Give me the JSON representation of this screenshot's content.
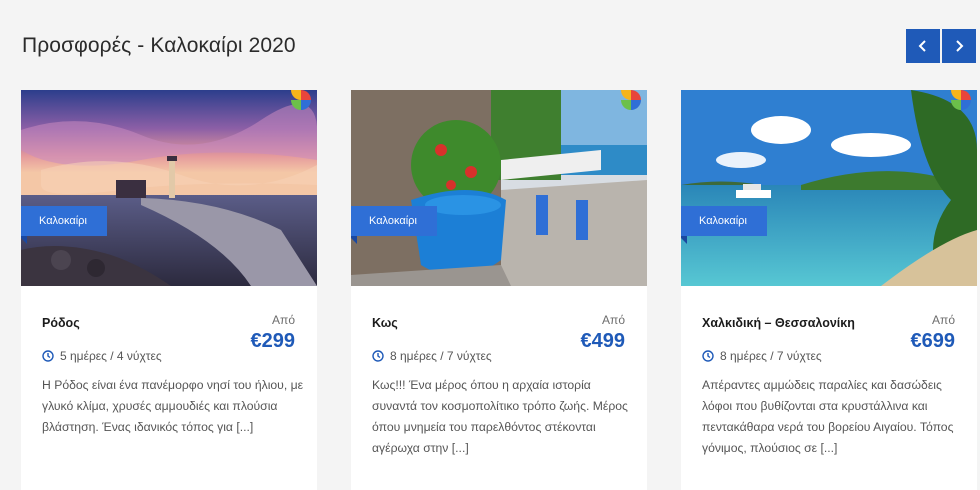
{
  "section": {
    "title": "Προσφορές - Καλοκαίρι 2020"
  },
  "carousel": {
    "prev_icon": "chevron-left-icon",
    "next_icon": "chevron-right-icon"
  },
  "colors": {
    "accent": "#1f5ab8",
    "badge": "#2f6fd6",
    "background": "#f4f4f4"
  },
  "cards": [
    {
      "badge": "Καλοκαίρι",
      "title": "Ρόδος",
      "price_prefix": "Από",
      "price": "€299",
      "duration": "5 ημέρες / 4 νύχτες",
      "description": "Η Ρόδος είναι ένα πανέμορφο νησί του ήλιου, με γλυκό κλίμα, χρυσές αμμουδιές και πλούσια βλάστηση. Ένας ιδανικός τόπος για [...]"
    },
    {
      "badge": "Καλοκαίρι",
      "title": "Κως",
      "price_prefix": "Από",
      "price": "€499",
      "duration": "8 ημέρες / 7 νύχτες",
      "description": "Κως!!! Ένα μέρος όπου η αρχαία ιστορία συναντά τον κοσμοπολίτικο τρόπο ζωής. Μέρος όπου μνημεία του παρελθόντος στέκονται αγέρωχα στην [...]"
    },
    {
      "badge": "Καλοκαίρι",
      "title": "Χαλκιδική – Θεσσαλονίκη",
      "price_prefix": "Από",
      "price": "€699",
      "duration": "8 ημέρες / 7 νύχτες",
      "description": "Απέραντες αμμώδεις παραλίες και δασώδεις λόφοι που βυθίζονται στα κρυστάλλινα και πεντακάθαρα νερά του βορείου Αιγαίου. Τόπος γόνιμος, πλούσιος σε [...]"
    }
  ]
}
